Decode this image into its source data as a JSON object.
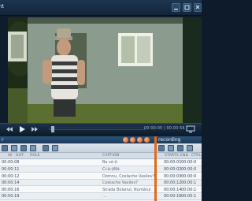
{
  "window": {
    "title": "nt"
  },
  "transport": {
    "timecode": "00:00:05 | 00:00:56",
    "progress": 0.02
  },
  "left_panel": {
    "title": "r",
    "columns": [
      "IN",
      "OUT",
      "ROLE",
      "CAPTION"
    ],
    "rows": [
      {
        "in": "",
        "out": "00:00:08",
        "caption": "Ba să-ți"
      },
      {
        "in": "",
        "out": "00:00:11",
        "caption": "Ci-ă-țiNă"
      },
      {
        "in": "",
        "out": "00:00:12",
        "caption": "Domnu, Costache Vasilev?"
      },
      {
        "in": "",
        "out": "00:00:14",
        "caption": "Costache Vasilev?"
      },
      {
        "in": "",
        "out": "00:00:16",
        "caption": "Strada Bolanul, Numărul"
      },
      {
        "in": "",
        "out": "00:00:19",
        "caption": "..."
      }
    ]
  },
  "right_panel": {
    "title": "recording",
    "columns": [
      "STARTS",
      "END",
      "CTRL"
    ],
    "rows": [
      {
        "start": "00:00:01",
        "end": "00:00:0"
      },
      {
        "start": "00:00:02",
        "end": "00:00:0"
      },
      {
        "start": "00:00:03",
        "end": "00:00:0"
      },
      {
        "start": "00:00:12",
        "end": "00:00:1"
      },
      {
        "start": "00:00:14",
        "end": "00:00:1"
      },
      {
        "start": "00:00:16",
        "end": "00:00:1"
      }
    ]
  },
  "colors": {
    "accent": "#e0691f",
    "chrome": "#1c3a58",
    "panel": "#eef1f4"
  }
}
